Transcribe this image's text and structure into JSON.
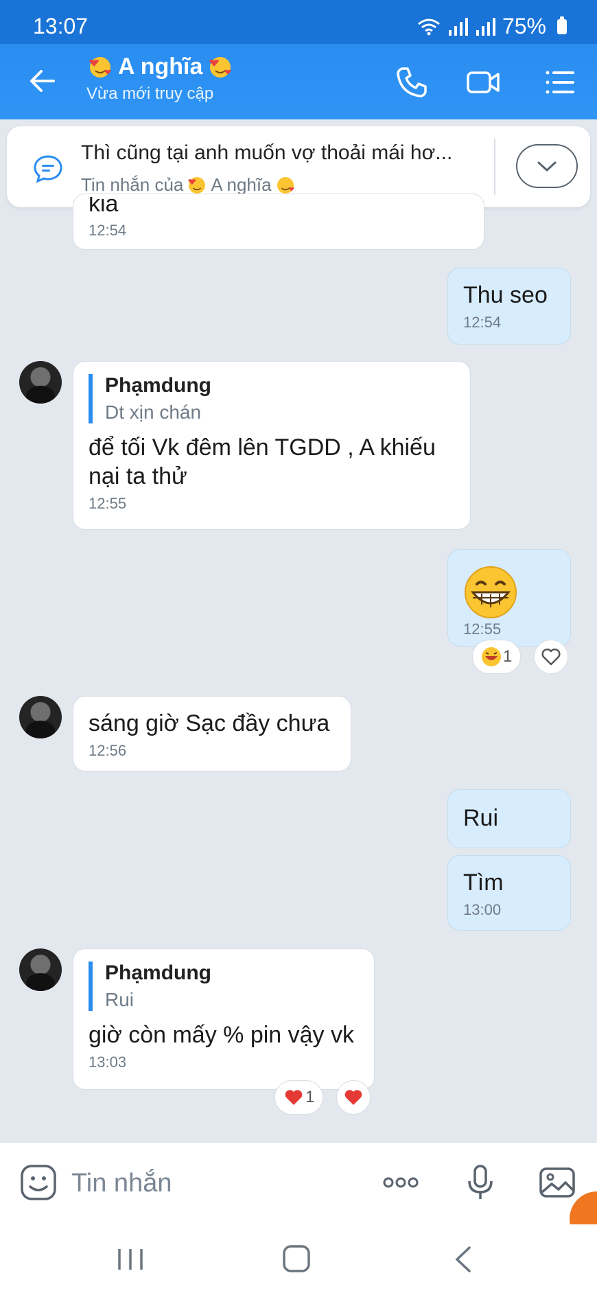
{
  "status_bar": {
    "time": "13:07",
    "battery": "75%"
  },
  "header": {
    "title": "A nghĩa",
    "subtitle": "Vừa mới truy cập"
  },
  "pinned": {
    "text": "Thì cũng tại anh muốn vợ thoải mái hơ...",
    "sub_prefix": "Tin nhắn của",
    "sub_name": "A nghĩa"
  },
  "messages": {
    "m0": {
      "text": "kia",
      "time": "12:54"
    },
    "m1": {
      "text": "Thu seo",
      "time": "12:54"
    },
    "m2": {
      "quote_author": "Phạmdung",
      "quote_text": "Dt xịn chán",
      "text": "để tối Vk đêm lên TGDD , A khiếu nại ta thử",
      "time": "12:55"
    },
    "m3": {
      "time": "12:55",
      "reaction_count": "1"
    },
    "m4": {
      "text": "sáng giờ Sạc đầy chưa",
      "time": "12:56"
    },
    "m5": {
      "text": "Rui"
    },
    "m6": {
      "text": "Tìm",
      "time": "13:00"
    },
    "m7": {
      "quote_author": "Phạmdung",
      "quote_text": "Rui",
      "text": "giờ còn mấy % pin vậy vk",
      "time": "13:03",
      "reaction_count": "1"
    }
  },
  "input": {
    "placeholder": "Tin nhắn"
  },
  "colors": {
    "header": "#2a8df0",
    "my_bubble": "#d7ecfc",
    "background": "#e3e8ef",
    "quote_bar": "#2a8df0"
  }
}
